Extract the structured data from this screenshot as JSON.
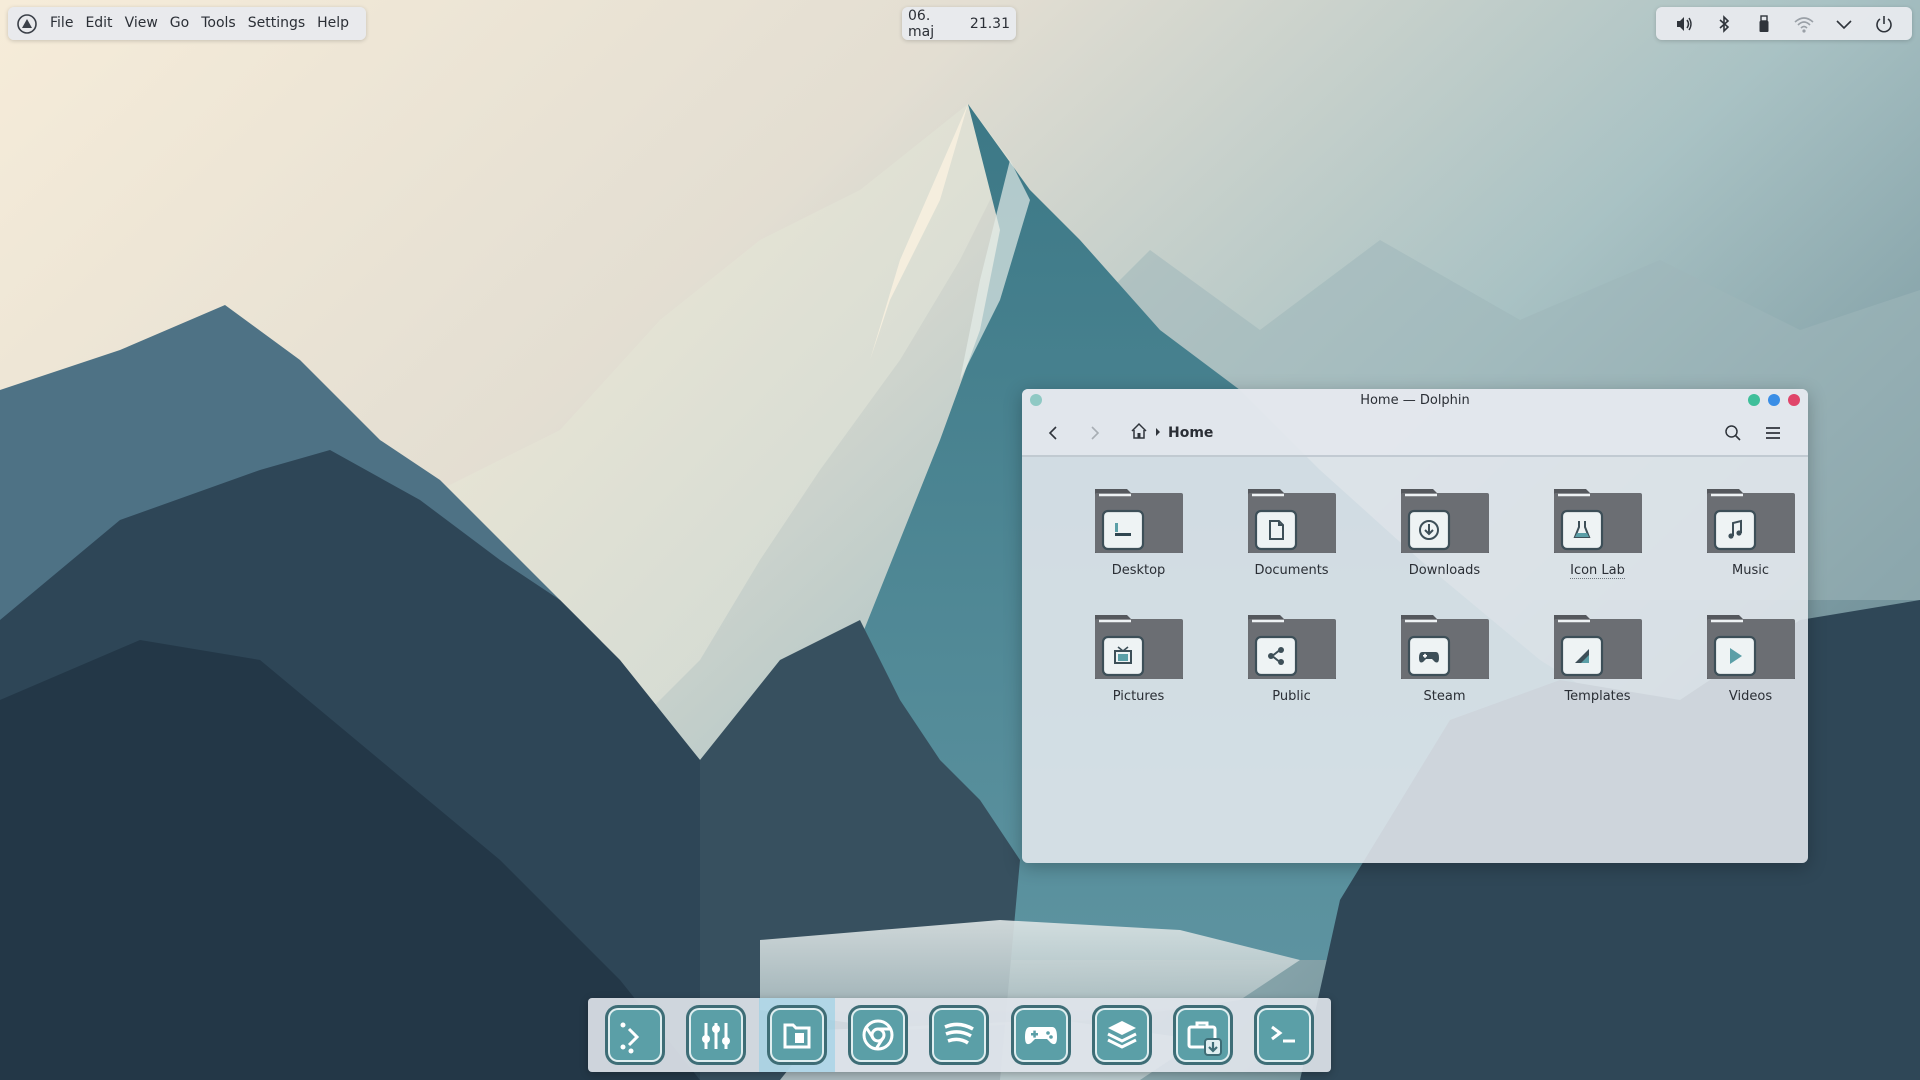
{
  "menubar": {
    "logo_icon": "app-logo-icon",
    "items": [
      "File",
      "Edit",
      "View",
      "Go",
      "Tools",
      "Settings",
      "Help"
    ]
  },
  "clock": {
    "date": "06. maj",
    "time": "21.31"
  },
  "tray": {
    "icons": [
      "volume-icon",
      "bluetooth-icon",
      "usb-drive-icon",
      "wifi-icon",
      "chevron-down-icon",
      "power-icon"
    ]
  },
  "window": {
    "title": "Home — Dolphin",
    "controls": {
      "minimize_color": "#3fbf9a",
      "maximize_color": "#3a8ee6",
      "close_color": "#e0456a"
    },
    "breadcrumb": {
      "home_icon": "home-icon",
      "current": "Home"
    },
    "folders": [
      {
        "label": "Desktop",
        "emblem": "desktop-icon"
      },
      {
        "label": "Documents",
        "emblem": "document-icon"
      },
      {
        "label": "Downloads",
        "emblem": "download-icon"
      },
      {
        "label": "Icon Lab",
        "emblem": "flask-icon"
      },
      {
        "label": "Music",
        "emblem": "music-note-icon"
      },
      {
        "label": "Pictures",
        "emblem": "picture-icon"
      },
      {
        "label": "Public",
        "emblem": "share-icon"
      },
      {
        "label": "Steam",
        "emblem": "gamepad-icon"
      },
      {
        "label": "Templates",
        "emblem": "template-icon"
      },
      {
        "label": "Videos",
        "emblem": "play-icon"
      }
    ]
  },
  "dock": {
    "items": [
      {
        "name": "launcher-icon",
        "active": false
      },
      {
        "name": "mixer-icon",
        "active": false
      },
      {
        "name": "files-icon",
        "active": true
      },
      {
        "name": "chrome-icon",
        "active": false
      },
      {
        "name": "spotify-icon",
        "active": false
      },
      {
        "name": "gamepad-icon",
        "active": false
      },
      {
        "name": "layers-icon",
        "active": false
      },
      {
        "name": "software-store-icon",
        "active": false
      },
      {
        "name": "terminal-icon",
        "active": false
      }
    ]
  },
  "colors": {
    "accent": "#5b9fa7",
    "folder_body": "#6b6e73",
    "folder_tab": "#55585d"
  }
}
